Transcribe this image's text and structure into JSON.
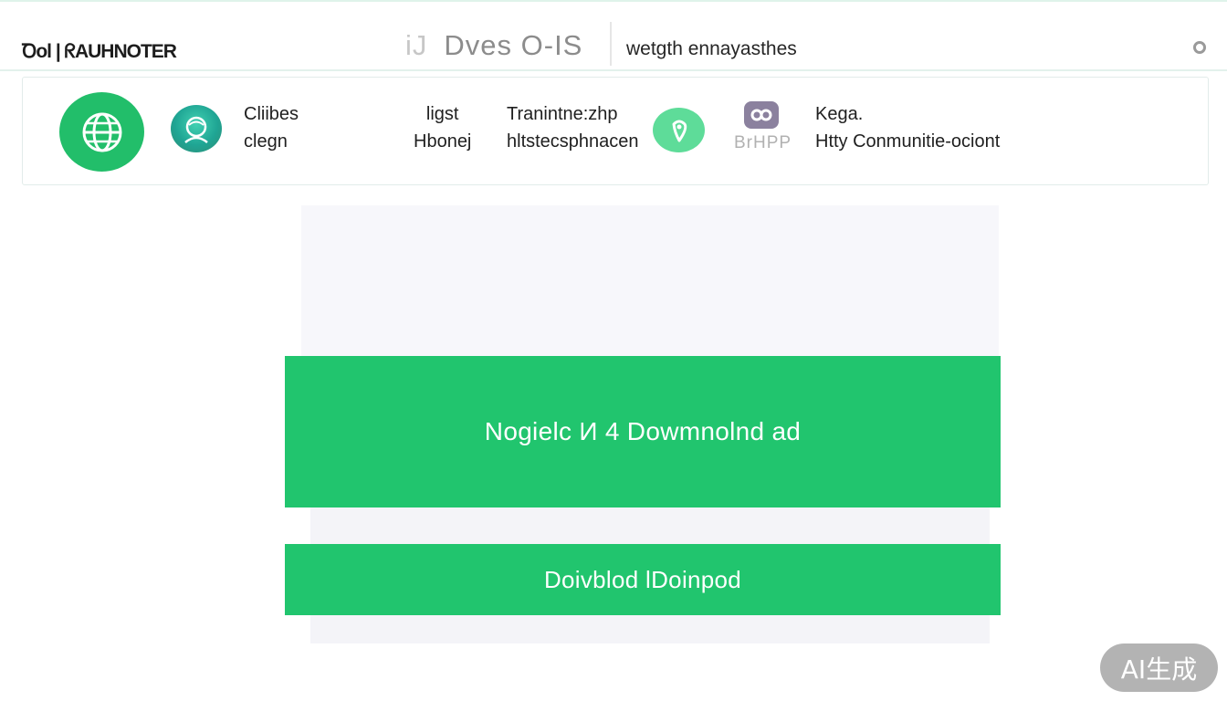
{
  "header": {
    "brand": "Ꝺol | ᖇAUHNOTER",
    "title_faint": "iJ",
    "title": "Dves O-IS",
    "subtitle": "wetgth ennayasthes"
  },
  "features": {
    "item1": {
      "line1": "Cliibes",
      "line2": "clegn"
    },
    "item2": {
      "line1": "ligst",
      "line2": "Hbonej"
    },
    "item3": {
      "line1": "Tranintne:zhp",
      "line2": "hltstecsphnacen"
    },
    "chat_label": "BrHPP",
    "item4": {
      "line1": "Kega.",
      "line2": "Htty Conmunitie-ociont"
    }
  },
  "buttons": {
    "primary": "Nogielc И 4 Dowmnolnd ad",
    "secondary": "Doivblod lDoinpod"
  },
  "watermark": "AI生成",
  "colors": {
    "accent": "#21c56e",
    "globe": "#22be6a",
    "pin": "#5edc99",
    "chat": "#8b819e"
  },
  "icons": [
    "globe-icon",
    "face-icon",
    "map-pin-icon",
    "chat-icon",
    "status-dot-icon"
  ]
}
